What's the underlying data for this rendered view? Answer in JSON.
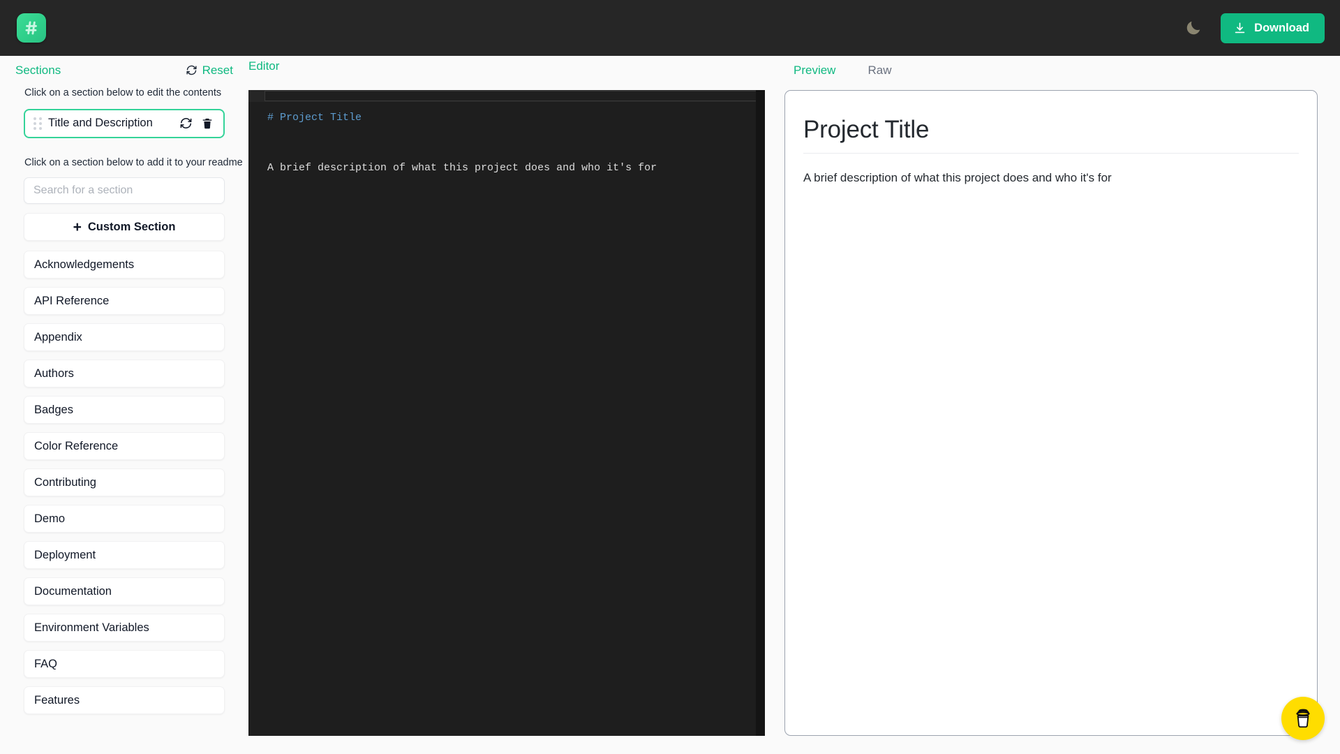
{
  "navbar": {
    "logo_icon": "hash-logo-icon",
    "theme_toggle_icon": "moon-icon",
    "download_icon": "download-icon",
    "download_label": "Download",
    "background_color": "#262626",
    "accent_color": "#10b981"
  },
  "sidebar": {
    "sections_title": "Sections",
    "reset_label": "Reset",
    "reset_icon": "refresh-icon",
    "edit_hint": "Click on a section below to edit the contents",
    "active_section": {
      "label": "Title and Description",
      "drag_icon": "drag-handle-icon",
      "reset_icon": "refresh-icon",
      "delete_icon": "trash-icon",
      "border_color": "#34d399"
    },
    "add_hint": "Click on a section below to add it to your readme",
    "search_placeholder": "Search for a section",
    "search_value": "",
    "custom_section_label": "Custom Section",
    "custom_section_icon": "plus-icon",
    "available_sections": [
      "Acknowledgements",
      "API Reference",
      "Appendix",
      "Authors",
      "Badges",
      "Color Reference",
      "Contributing",
      "Demo",
      "Deployment",
      "Documentation",
      "Environment Variables",
      "FAQ",
      "Features"
    ]
  },
  "editor": {
    "label": "Editor",
    "heading_line": "# Project Title",
    "blank_line": "",
    "body_line": "A brief description of what this project does and who it's for",
    "background_color": "#1e1e1e",
    "heading_color": "#5d9ccf",
    "text_color": "#dcdcdc"
  },
  "preview": {
    "tabs": [
      {
        "label": "Preview",
        "active": true
      },
      {
        "label": "Raw",
        "active": false
      }
    ],
    "title": "Project Title",
    "description": "A brief description of what this project does and who it's for"
  },
  "fab": {
    "icon": "coffee-cup-icon",
    "background_color": "#ffdd00"
  }
}
